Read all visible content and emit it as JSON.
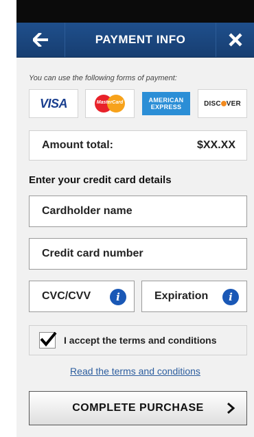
{
  "header": {
    "title": "PAYMENT INFO",
    "back_icon": "arrow-left-icon",
    "close_icon": "close-icon",
    "bar_color": "#1f4f8c"
  },
  "payment_methods": {
    "note": "You can use the following forms of payment:",
    "cards": [
      {
        "name": "VISA",
        "icon": "visa-logo"
      },
      {
        "name": "MasterCard",
        "icon": "mastercard-logo"
      },
      {
        "name": "AMERICAN EXPRESS",
        "icon": "amex-logo",
        "line1": "AMERICAN",
        "line2": "EXPRESS"
      },
      {
        "name": "DISCOVER",
        "icon": "discover-logo",
        "part1": "DISC",
        "part2": "VER"
      }
    ]
  },
  "amount": {
    "label": "Amount total:",
    "value": "$XX.XX"
  },
  "card_details": {
    "heading": "Enter your credit card details",
    "cardholder_placeholder": "Cardholder name",
    "card_number_placeholder": "Credit card number",
    "cvc_placeholder": "CVC/CVV",
    "expiration_placeholder": "Expiration",
    "info_icon": "info-icon"
  },
  "terms": {
    "checked": true,
    "label": "I accept the terms and conditions",
    "link": "Read the terms and conditions"
  },
  "submit": {
    "label": "COMPLETE PURCHASE",
    "icon": "chevron-right-icon"
  }
}
